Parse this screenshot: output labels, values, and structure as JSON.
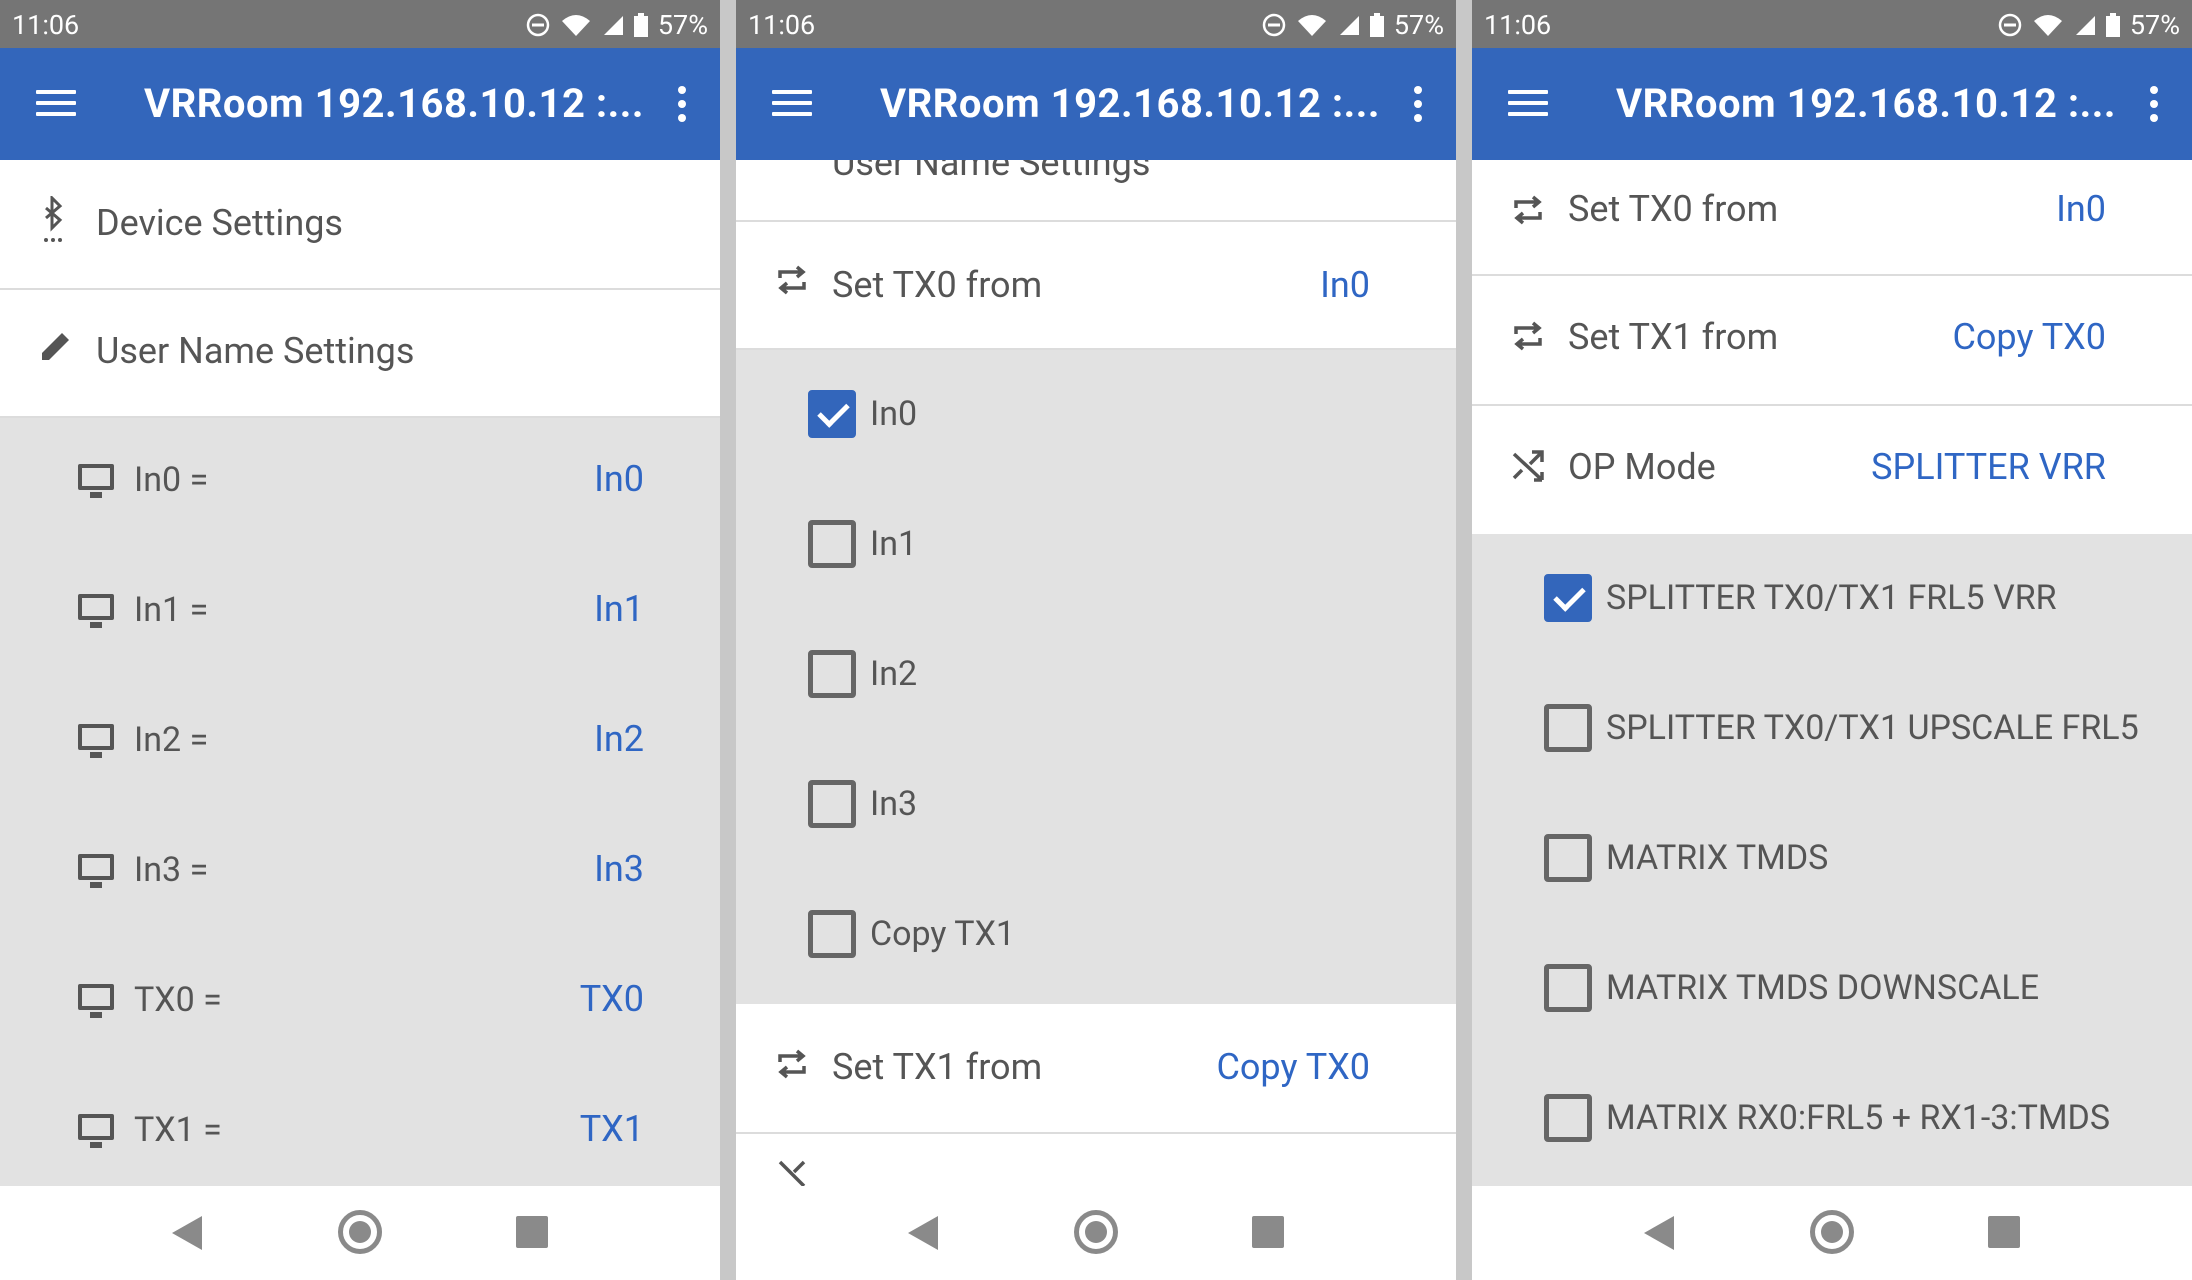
{
  "status": {
    "time": "11:06",
    "battery": "57%"
  },
  "app": {
    "title": "VRRoom 192.168.10.12 :..."
  },
  "panel1": {
    "device_settings": "Device Settings",
    "user_name_settings": "User Name Settings",
    "items": [
      {
        "label": "In0 =",
        "value": "In0"
      },
      {
        "label": "In1 =",
        "value": "In1"
      },
      {
        "label": "In2 =",
        "value": "In2"
      },
      {
        "label": "In3 =",
        "value": "In3"
      },
      {
        "label": "TX0 =",
        "value": "TX0"
      },
      {
        "label": "TX1 =",
        "value": "TX1"
      }
    ]
  },
  "panel2": {
    "partial_top": "User Name Settings",
    "set_tx0": {
      "label": "Set TX0 from",
      "value": "In0"
    },
    "options": [
      {
        "label": "In0",
        "checked": true
      },
      {
        "label": "In1",
        "checked": false
      },
      {
        "label": "In2",
        "checked": false
      },
      {
        "label": "In3",
        "checked": false
      },
      {
        "label": "Copy TX1",
        "checked": false
      }
    ],
    "set_tx1": {
      "label": "Set TX1 from",
      "value": "Copy TX0"
    }
  },
  "panel3": {
    "set_tx0": {
      "label": "Set TX0 from",
      "value": "In0"
    },
    "set_tx1": {
      "label": "Set TX1 from",
      "value": "Copy TX0"
    },
    "op_mode": {
      "label": "OP Mode",
      "value": "SPLITTER VRR"
    },
    "options": [
      {
        "label": "SPLITTER TX0/TX1 FRL5 VRR",
        "checked": true
      },
      {
        "label": "SPLITTER TX0/TX1 UPSCALE FRL5",
        "checked": false
      },
      {
        "label": "MATRIX TMDS",
        "checked": false
      },
      {
        "label": "MATRIX TMDS DOWNSCALE",
        "checked": false
      },
      {
        "label": "MATRIX RX0:FRL5 + RX1-3:TMDS",
        "checked": false
      }
    ]
  },
  "icons": {
    "bluetooth": "bluetooth-icon",
    "pencil": "pencil-icon",
    "monitor": "monitor-icon",
    "repeat": "repeat-icon",
    "shuffle": "shuffle-icon",
    "wifi": "wifi-icon",
    "signal": "signal-icon",
    "battery": "battery-icon",
    "dnd": "do-not-disturb-icon"
  },
  "colors": {
    "accent": "#3366bb",
    "link": "#2f66c4",
    "statusbar": "#757575",
    "expanded_bg": "#e2e2e2"
  }
}
